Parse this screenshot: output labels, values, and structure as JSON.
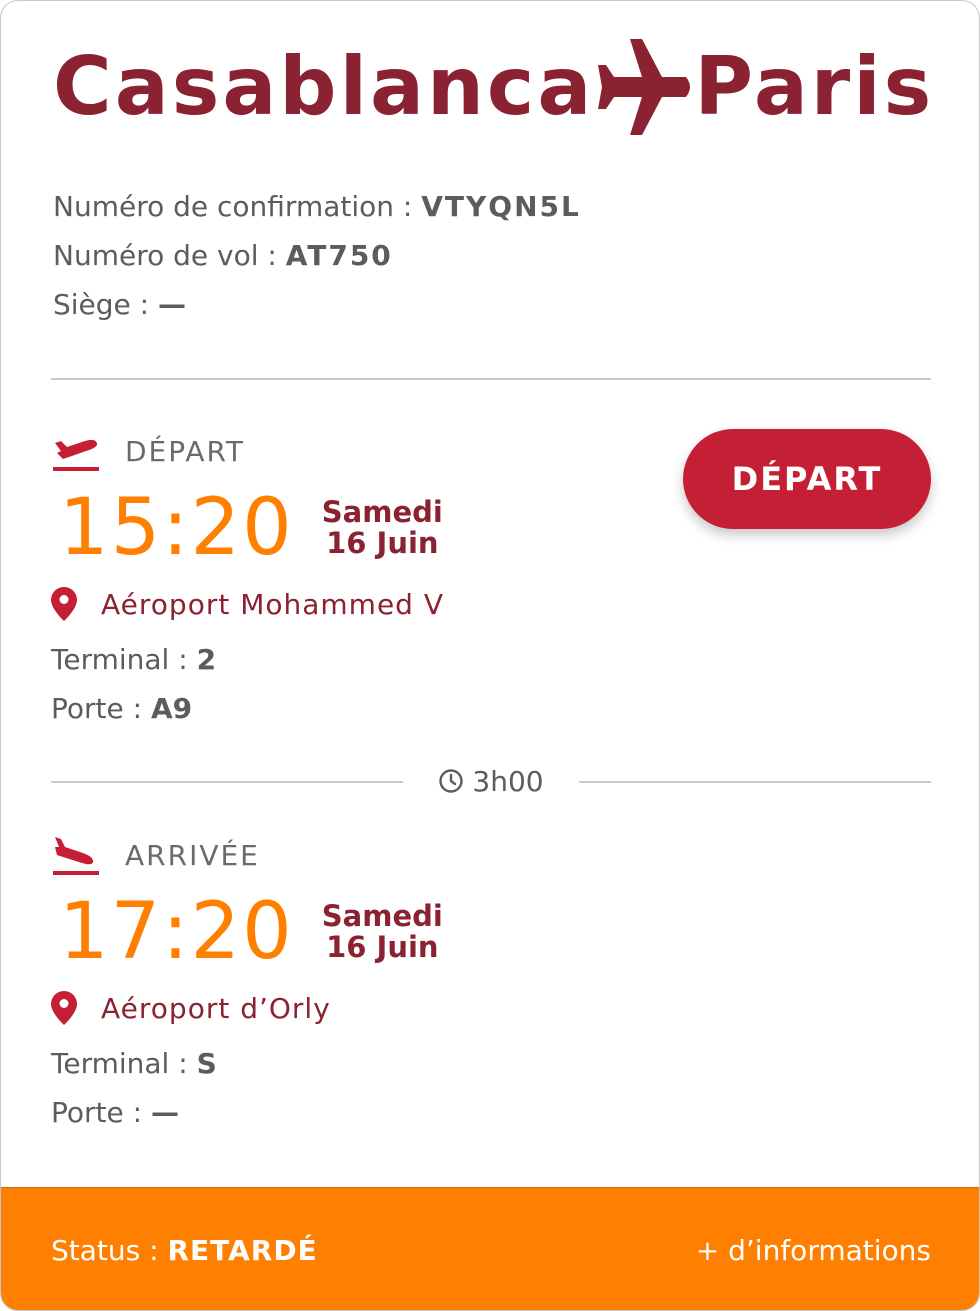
{
  "route": {
    "origin": "Casablanca",
    "destination": "Paris"
  },
  "booking": {
    "confirmation_label": "Numéro de confirmation : ",
    "confirmation_value": "VTYQN5L",
    "flight_label": "Numéro de vol : ",
    "flight_value": "AT750",
    "seat_label": "Siège : ",
    "seat_value": "—"
  },
  "departure": {
    "label": "DÉPART",
    "time": "15:20",
    "day": "Samedi",
    "date": "16 Juin",
    "airport": "Aéroport Mohammed V",
    "terminal_label": "Terminal : ",
    "terminal_value": "2",
    "gate_label": "Porte : ",
    "gate_value": "A9"
  },
  "status_button": {
    "label": "DÉPART"
  },
  "duration": "3h00",
  "arrival": {
    "label": "ARRIVÉE",
    "time": "17:20",
    "day": "Samedi",
    "date": "16 Juin",
    "airport": "Aéroport d’Orly",
    "terminal_label": "Terminal : ",
    "terminal_value": "S",
    "gate_label": "Porte : ",
    "gate_value": "—"
  },
  "footer": {
    "status_label": "Status : ",
    "status_value": "RETARDÉ",
    "more_label": "+ d’informations"
  },
  "colors": {
    "brand": "#8a2231",
    "accent": "#ff7f00",
    "button": "#c41f35"
  },
  "icons": {
    "route": "airplane-icon",
    "departure": "takeoff-icon",
    "arrival": "landing-icon",
    "location": "map-pin-icon",
    "duration": "clock-icon"
  }
}
